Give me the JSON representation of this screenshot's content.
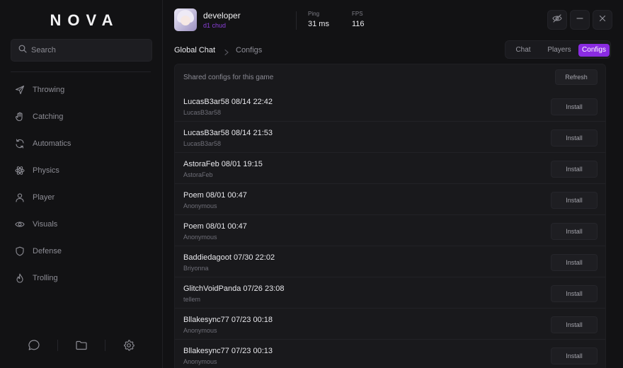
{
  "app": {
    "logo": "NOVA"
  },
  "search": {
    "placeholder": "Search"
  },
  "sidebar": {
    "items": [
      {
        "label": "Throwing",
        "icon": "send-icon"
      },
      {
        "label": "Catching",
        "icon": "hand-icon"
      },
      {
        "label": "Automatics",
        "icon": "refresh-icon"
      },
      {
        "label": "Physics",
        "icon": "atom-icon"
      },
      {
        "label": "Player",
        "icon": "user-icon"
      },
      {
        "label": "Visuals",
        "icon": "eye-icon"
      },
      {
        "label": "Defense",
        "icon": "shield-icon"
      },
      {
        "label": "Trolling",
        "icon": "flame-icon"
      }
    ],
    "bottom_icons": [
      "chat-bubble-icon",
      "folder-icon",
      "gear-icon"
    ]
  },
  "header": {
    "username": "developer",
    "role": "d1 chud",
    "stats": [
      {
        "label": "Ping",
        "value": "31 ms"
      },
      {
        "label": "FPS",
        "value": "116"
      }
    ],
    "window_buttons": [
      "eye-off-icon",
      "minimize-icon",
      "close-icon"
    ]
  },
  "breadcrumb": {
    "root": "Global Chat",
    "current": "Configs"
  },
  "tabs": [
    {
      "label": "Chat",
      "active": false
    },
    {
      "label": "Players",
      "active": false
    },
    {
      "label": "Configs",
      "active": true
    }
  ],
  "configs": {
    "title": "Shared configs for this game",
    "refresh_label": "Refresh",
    "install_label": "Install",
    "items": [
      {
        "title": "LucasB3ar58 08/14 22:42",
        "author": "LucasB3ar58"
      },
      {
        "title": "LucasB3ar58 08/14 21:53",
        "author": "LucasB3ar58"
      },
      {
        "title": "AstoraFeb 08/01 19:15",
        "author": "AstoraFeb"
      },
      {
        "title": "Poem 08/01 00:47",
        "author": "Anonymous"
      },
      {
        "title": "Poem 08/01 00:47",
        "author": "Anonymous"
      },
      {
        "title": "Baddiedagoot 07/30 22:02",
        "author": "Briyonna"
      },
      {
        "title": "GlitchVoidPanda 07/26 23:08",
        "author": "tellem"
      },
      {
        "title": "Bllakesync77 07/23 00:18",
        "author": "Anonymous"
      },
      {
        "title": "Bllakesync77 07/23 00:13",
        "author": "Anonymous"
      }
    ]
  },
  "colors": {
    "accent": "#8a2be2",
    "role": "#8a3fd8",
    "background": "#121214",
    "panel": "#19191c"
  }
}
